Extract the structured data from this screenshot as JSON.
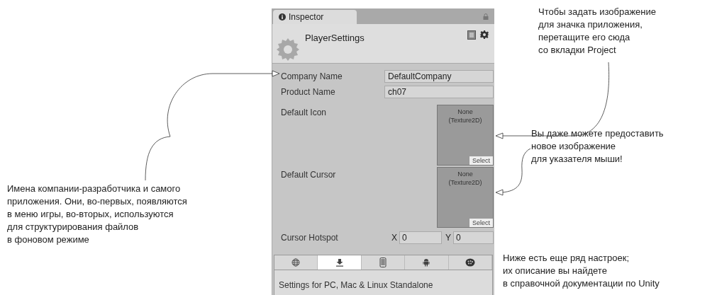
{
  "inspector": {
    "tab": "Inspector",
    "title": "PlayerSettings",
    "fields": [
      {
        "label": "Company Name",
        "value": "DefaultCompany"
      },
      {
        "label": "Product Name",
        "value": "ch07"
      }
    ],
    "textures": [
      {
        "label": "Default Icon",
        "value": "None\n(Texture2D)",
        "button": "Select"
      },
      {
        "label": "Default Cursor",
        "value": "None\n(Texture2D)",
        "button": "Select"
      }
    ],
    "hotspot": {
      "label": "Cursor Hotspot",
      "x_label": "X",
      "x_value": "0",
      "y_label": "Y",
      "y_value": "0"
    },
    "platform_tabs": [
      {
        "kind": "web",
        "selected": false
      },
      {
        "kind": "standalone",
        "selected": true
      },
      {
        "kind": "mobile",
        "selected": false
      },
      {
        "kind": "android",
        "selected": false
      },
      {
        "kind": "blackberry",
        "selected": false
      }
    ],
    "section_title": "Settings for PC, Mac & Linux Standalone"
  },
  "annotations": {
    "left": "Имена компании-разработчика и самого\nприложения. Они, во-первых, появляются\nв меню игры, во-вторых, используются\nдля структурирования файлов\nв фоновом режиме",
    "icon": "Чтобы задать изображение\nдля значка приложения,\nперетащите его сюда\nсо вкладки Project",
    "cursor": "Вы даже можете предоставить\nновое изображение\nдля указателя мыши!",
    "more": "Ниже есть еще ряд настроек;\nих описание вы найдете\nв справочной документации по Unity"
  }
}
